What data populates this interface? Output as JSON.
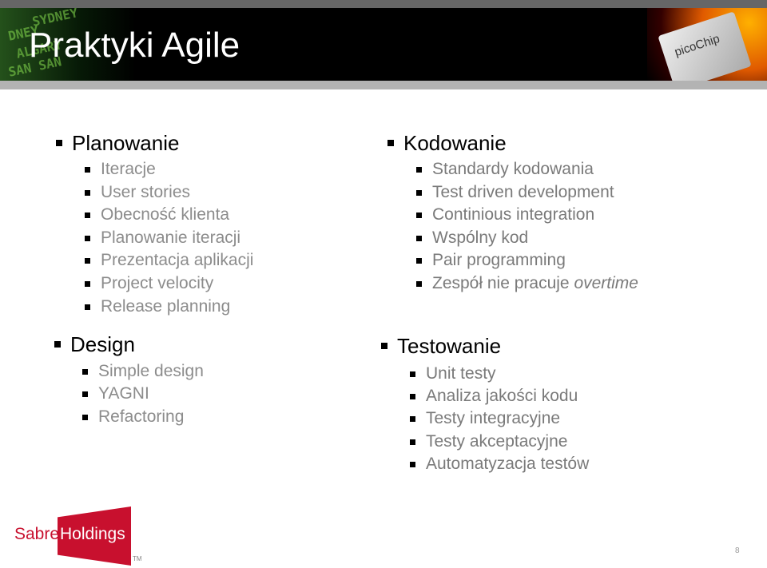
{
  "header": {
    "title": "Praktyki Agile",
    "banner_chip_text": "picoChip"
  },
  "left": {
    "planowanie": {
      "label": "Planowanie",
      "items": [
        "Iteracje",
        "User stories",
        "Obecność klienta",
        "Planowanie iteracji",
        "Prezentacja aplikacji",
        "Project velocity",
        "Release planning"
      ]
    },
    "design": {
      "label": "Design",
      "items": [
        "Simple design",
        "YAGNI",
        "Refactoring"
      ]
    }
  },
  "right": {
    "kodowanie": {
      "label": "Kodowanie",
      "items": [
        "Standardy kodowania",
        "Test driven development",
        "Continious integration",
        "Wspólny kod",
        "Pair programming"
      ],
      "last_item": {
        "text": "Zespół nie pracuje ",
        "emphasis": "overtime"
      }
    },
    "testowanie": {
      "label": "Testowanie",
      "items": [
        "Unit testy",
        "Analiza jakości kodu",
        "Testy integracyjne",
        "Testy akceptacyjne",
        "Automatyzacja testów"
      ]
    }
  },
  "footer": {
    "logo_left": "Sabre",
    "logo_right": "Holdings",
    "tm": "TM",
    "page_number": "8",
    "brand_color": "#c8102e"
  }
}
